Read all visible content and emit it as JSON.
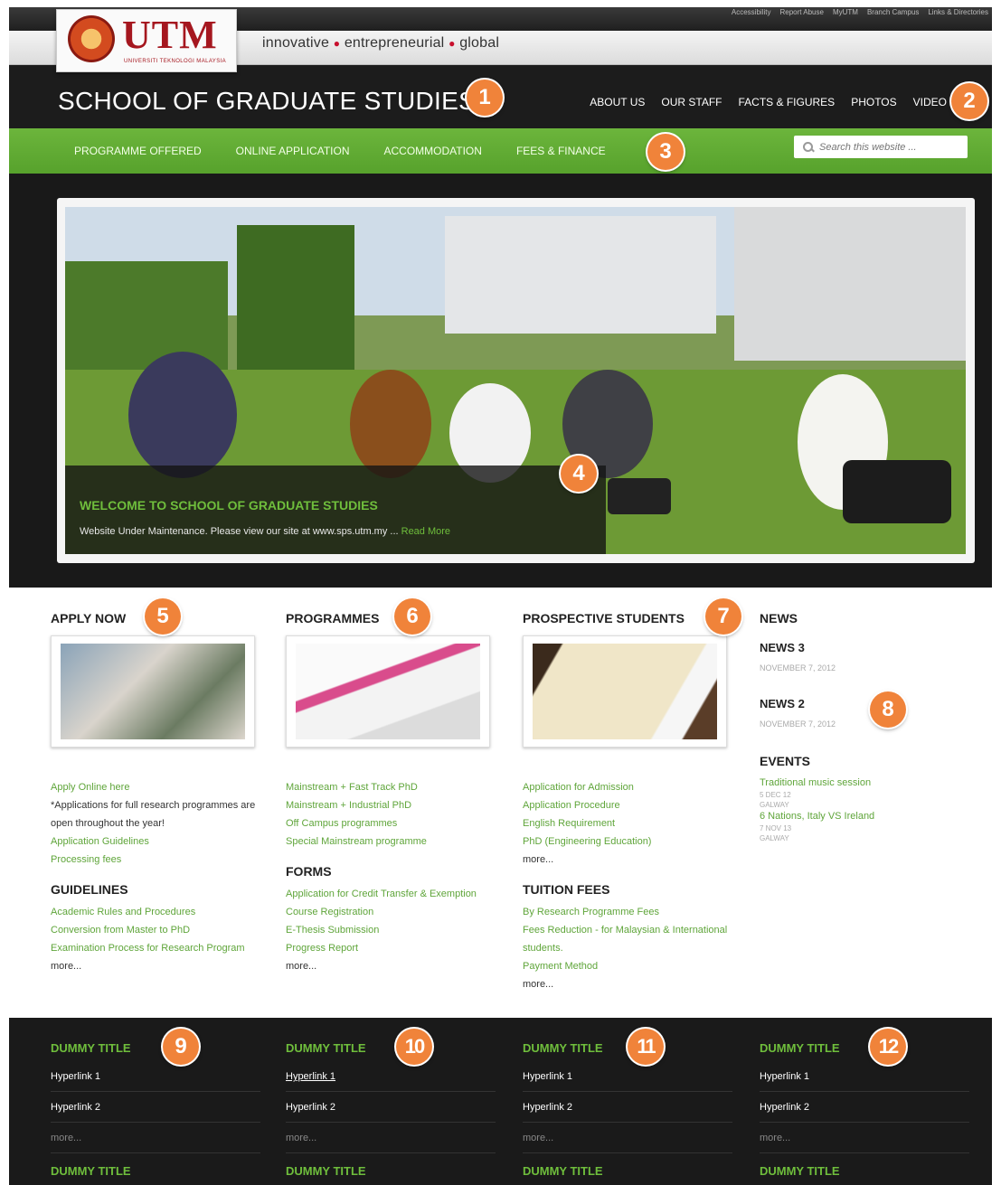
{
  "utility_links": [
    "Accessibility",
    "Report Abuse",
    "MyUTM",
    "Branch Campus",
    "Links & Directories"
  ],
  "logo": {
    "word": "UTM",
    "sub": "UNIVERSITI TEKNOLOGI MALAYSIA"
  },
  "tagline": {
    "w1": "innovative",
    "w2": "entrepreneurial",
    "w3": "global"
  },
  "header": {
    "title": "SCHOOL OF GRADUATE STUDIES"
  },
  "main_nav": [
    "ABOUT US",
    "OUR STAFF",
    "FACTS & FIGURES",
    "PHOTOS",
    "VIDEO"
  ],
  "green_nav": [
    "PROGRAMME OFFERED",
    "ONLINE APPLICATION",
    "ACCOMMODATION",
    "FEES & FINANCE"
  ],
  "search": {
    "placeholder": "Search this website ..."
  },
  "hero": {
    "title": "WELCOME TO SCHOOL OF GRADUATE STUDIES",
    "text": "Website Under Maintenance. Please view our site at www.sps.utm.my ...",
    "read_more": "Read More"
  },
  "badges": [
    "1",
    "2",
    "3",
    "4",
    "5",
    "6",
    "7",
    "8",
    "9",
    "10",
    "11",
    "12"
  ],
  "apply": {
    "heading": "APPLY NOW",
    "link1": "Apply Online here",
    "note": "*Applications for full research programmes are open throughout the year!",
    "link2": "Application Guidelines",
    "link3": "Processing fees",
    "guidelines_heading": "GUIDELINES",
    "g1": "Academic Rules and Procedures",
    "g2": "Conversion from Master to PhD",
    "g3": "Examination Process for Research Program",
    "more": "more..."
  },
  "programmes": {
    "heading": "PROGRAMMES",
    "p1": "Mainstream + Fast Track PhD",
    "p2": "Mainstream + Industrial PhD",
    "p3": "Off Campus programmes",
    "p4": "Special Mainstream programme",
    "forms_heading": "FORMS",
    "f1": "Application for Credit Transfer & Exemption",
    "f2": "Course Registration",
    "f3": "E-Thesis Submission",
    "f4": "Progress Report",
    "more": "more..."
  },
  "prospective": {
    "heading": "PROSPECTIVE STUDENTS",
    "s1": "Application for Admission",
    "s2": "Application Procedure",
    "s3": "English Requirement",
    "s4": "PhD (Engineering Education)",
    "more1": "more...",
    "tuition_heading": "TUITION FEES",
    "t1": "By Research Programme Fees",
    "t2": "Fees Reduction - for Malaysian & International students.",
    "t3": "Payment Method",
    "more2": "more..."
  },
  "news": {
    "heading": "NEWS",
    "n1": "NEWS 3",
    "d1": "NOVEMBER 7, 2012",
    "n2": "NEWS 2",
    "d2": "NOVEMBER 7, 2012",
    "events_heading": "EVENTS",
    "e1": "Traditional music session",
    "e1_date": "5 DEC 12",
    "e1_place": "GALWAY",
    "e2": "6 Nations, Italy VS Ireland",
    "e2_date": "7 NOV 13",
    "e2_place": "GALWAY"
  },
  "footer": {
    "title": "DUMMY TITLE",
    "h1": "Hyperlink 1",
    "h2": "Hyperlink 2",
    "more": "more..."
  },
  "colors": {
    "green": "#5fa53a",
    "badge": "#f0833a",
    "header": "#1c1c1c",
    "brand_red": "#a5171f"
  }
}
